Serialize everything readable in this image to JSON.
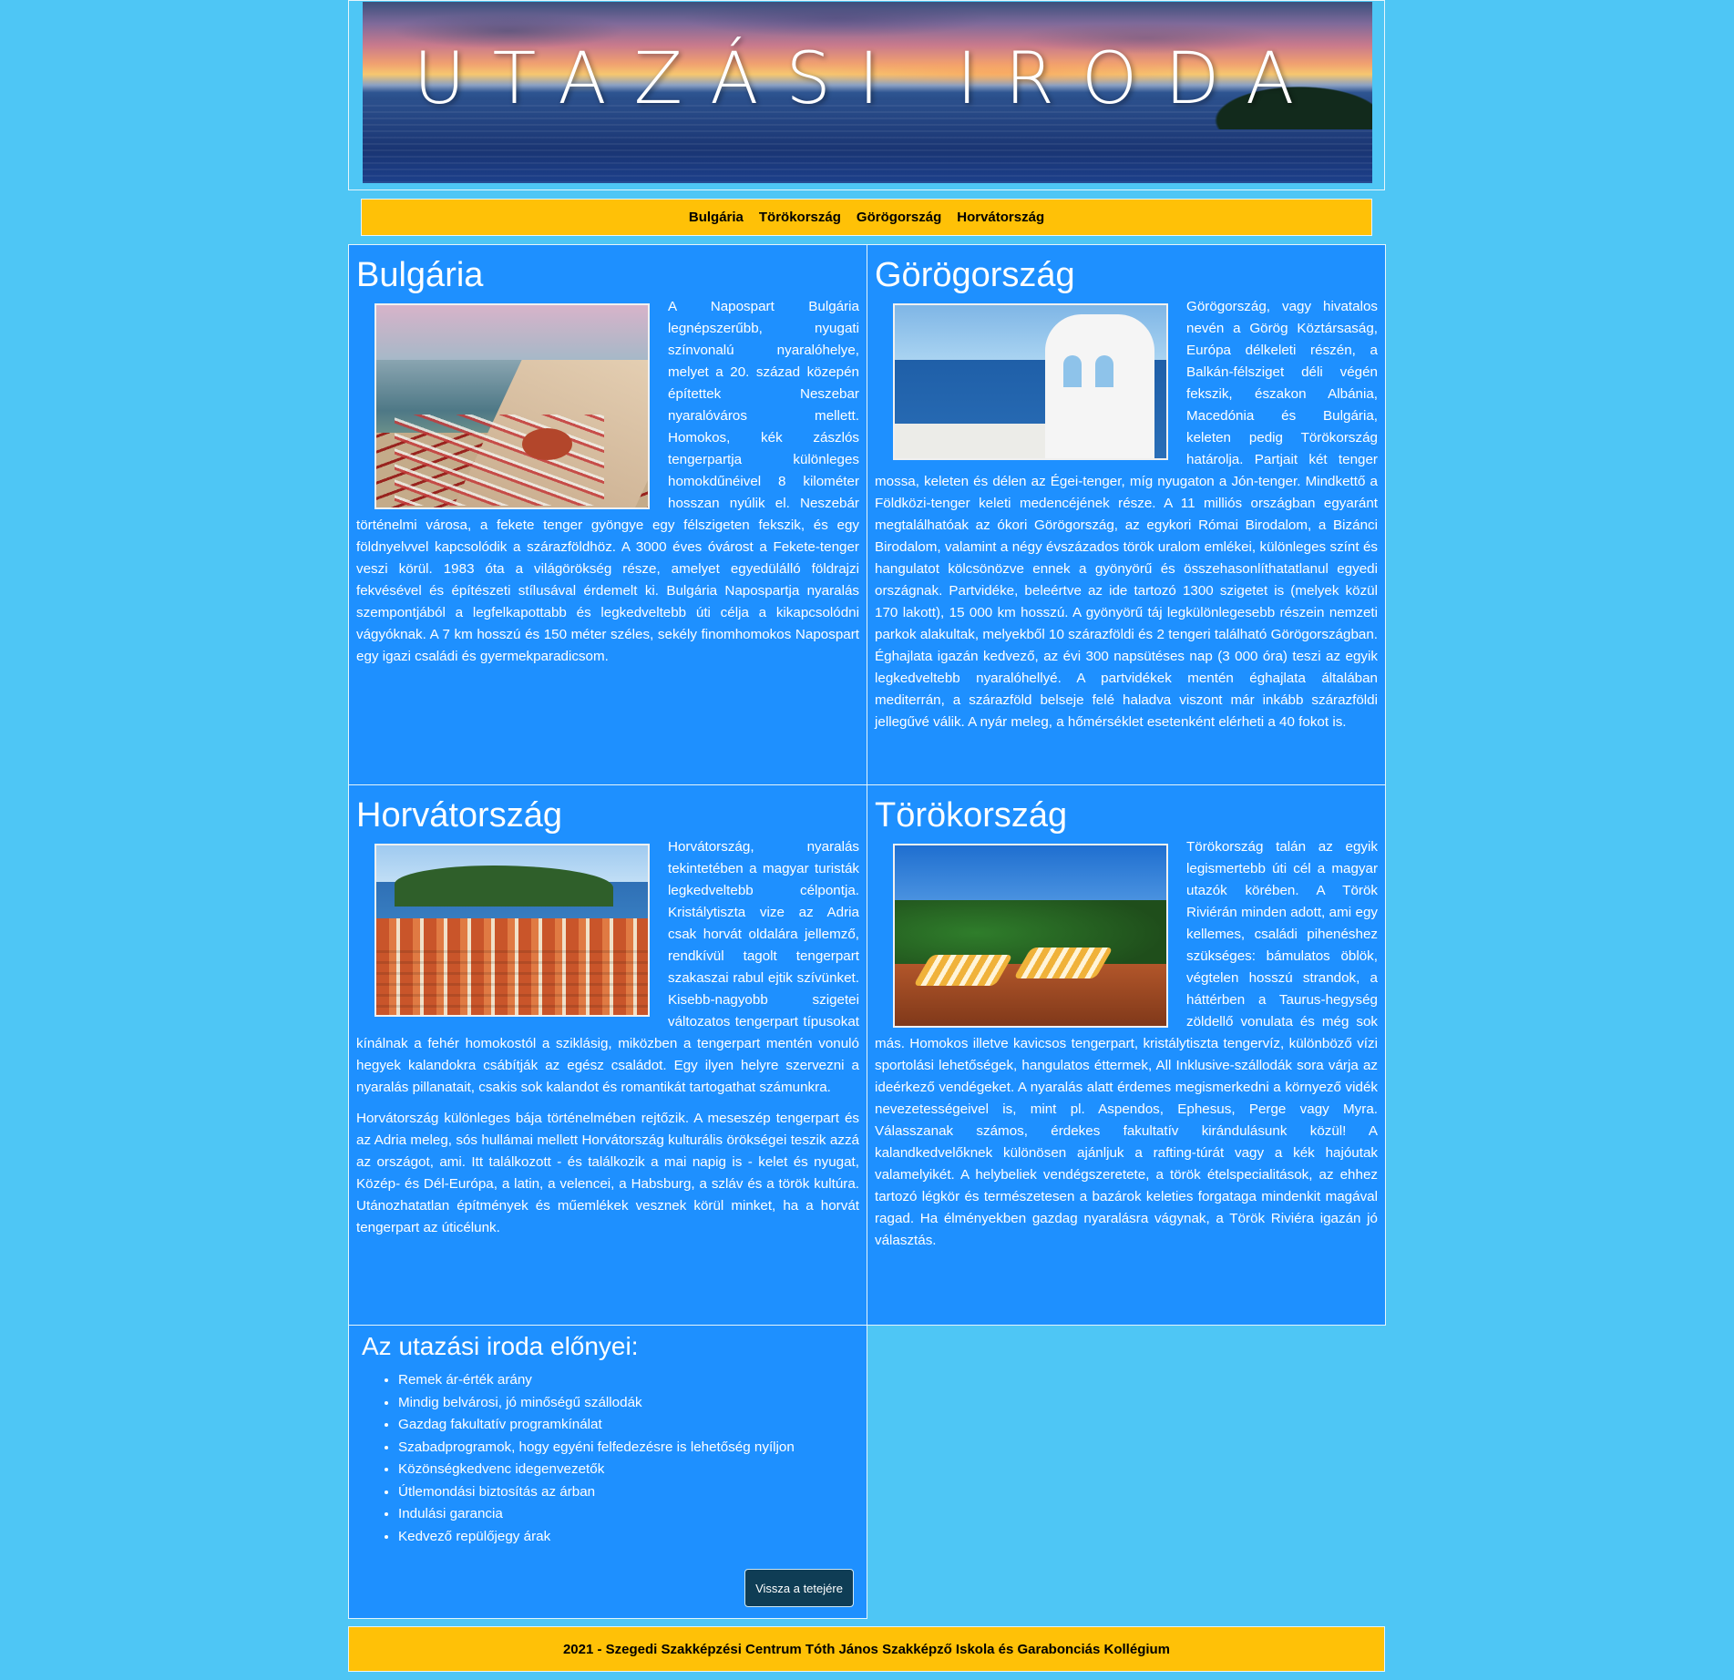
{
  "header": {
    "title": "UTAZÁSI IRODA"
  },
  "nav": {
    "items": [
      {
        "label": "Bulgária"
      },
      {
        "label": "Törökország"
      },
      {
        "label": "Görögország"
      },
      {
        "label": "Horvátország"
      }
    ]
  },
  "sections": {
    "bulgaria": {
      "title": "Bulgária",
      "text": "A Napospart Bulgária legnépszerűbb, nyugati színvonalú nyaralóhelye, melyet a 20. század közepén építettek Neszebar nyaralóváros mellett. Homokos, kék zászlós tengerpartja különleges homokdűnéivel 8 kilométer hosszan nyúlik el. Neszebár történelmi városa, a fekete tenger gyöngye egy félszigeten fekszik, és egy földnyelvvel kapcsolódik a szárazföldhöz. A 3000 éves óvárost a Fekete-tenger veszi körül. 1983 óta a világörökség része, amelyet egyedülálló földrajzi fekvésével és építészeti stílusával érdemelt ki. Bulgária Napospartja nyaralás szempontjából a legfelkapottabb és legkedveltebb úti célja a kikapcsolódni vágyóknak. A 7 km hosszú és 150 méter széles, sekély finomhomokos Napospart egy igazi családi és gyermekparadicsom."
    },
    "greece": {
      "title": "Görögország",
      "text": "Görögország, vagy hivatalos nevén a Görög Köztársaság, Európa délkeleti részén, a Balkán-félsziget déli végén fekszik, északon Albánia, Macedónia és Bulgária, keleten pedig Törökország határolja. Partjait két tenger mossa, keleten és délen az Égei-tenger, míg nyugaton a Jón-tenger. Mindkettő a Földközi-tenger keleti medencéjének része. A 11 milliós országban egyaránt megtalálhatóak az ókori Görögország, az egykori Római Birodalom, a Bizánci Birodalom, valamint a négy évszázados török uralom emlékei, különleges színt és hangulatot kölcsönözve ennek a gyönyörű és összehasonlíthatatlanul egyedi országnak. Partvidéke, beleértve az ide tartozó 1300 szigetet is (melyek közül 170 lakott), 15 000 km hosszú. A gyönyörű táj legkülönlegesebb részein nemzeti parkok alakultak, melyekből 10 szárazföldi és 2 tengeri található Görögországban. Éghajlata igazán kedvező, az évi 300 napsütéses nap (3 000 óra) teszi az egyik legkedveltebb nyaralóhellyé. A partvidékek mentén éghajlata általában mediterrán, a szárazföld belseje felé haladva viszont már inkább szárazföldi jellegűvé válik. A nyár meleg, a hőmérséklet esetenként elérheti a 40 fokot is."
    },
    "croatia": {
      "title": "Horvátország",
      "text1": "Horvátország, nyaralás tekintetében a magyar turisták legkedveltebb célpontja. Kristálytiszta vize az Adria csak horvát oldalára jellemző, rendkívül tagolt tengerpart szakaszai rabul ejtik szívünket. Kisebb-nagyobb szigetei változatos tengerpart típusokat kínálnak a fehér homokostól a sziklásig, miközben a tengerpart mentén vonuló hegyek kalandokra csábítják az egész családot. Egy ilyen helyre szervezni a nyaralás pillanatait, csakis sok kalandot és romantikát tartogathat számunkra.",
      "text2": "Horvátország különleges bája történelmében rejtőzik. A meseszép tengerpart és az Adria meleg, sós hullámai mellett Horvátország kulturális örökségei teszik azzá az országot, ami. Itt találkozott - és találkozik a mai napig is - kelet és nyugat, Közép- és Dél-Európa, a latin, a velencei, a Habsburg, a szláv és a török kultúra. Utánozhatatlan építmények és műemlékek vesznek körül minket, ha a horvát tengerpart az úticélunk."
    },
    "turkey": {
      "title": "Törökország",
      "text": "Törökország talán az egyik legismertebb úti cél a magyar utazók körében. A Török Riviérán minden adott, ami egy kellemes, családi pihenéshez szükséges: bámulatos öblök, végtelen hosszú strandok, a háttérben a Taurus-hegység zöldellő vonulata és még sok más. Homokos illetve kavicsos tengerpart, kristálytiszta tengervíz, különböző vízi sportolási lehetőségek, hangulatos éttermek, All Inklusive-szállodák sora várja az ideérkező vendégeket. A nyaralás alatt érdemes megismerkedni a környező vidék nevezetességeivel is, mint pl. Aspendos, Ephesus, Perge vagy Myra. Válasszanak számos, érdekes fakultatív kirándulásunk közül! A kalandkedvelőknek különösen ajánljuk a rafting-túrát vagy a kék hajóutak valamelyikét. A helybeliek vendégszeretete, a török ételspecialitások, az ehhez tartozó légkör és természetesen a bazárok keleties forgataga mindenkit magával ragad. Ha élményekben gazdag nyaralásra vágynak, a Török Riviéra igazán jó választás."
    }
  },
  "advantages": {
    "title": "Az utazási iroda előnyei:",
    "items": [
      "Remek ár-érték arány",
      "Mindig belvárosi, jó minőségű szállodák",
      "Gazdag fakultatív programkínálat",
      "Szabadprogramok, hogy egyéni felfedezésre is lehetőség nyíljon",
      "Közönségkedvenc idegenvezetők",
      "Útlemondási biztosítás az árban",
      "Indulási garancia",
      "Kedvező repülőjegy árak"
    ],
    "back_to_top": "Vissza a tetejére"
  },
  "footer": {
    "text": "2021 - Szegedi Szakképzési Centrum Tóth János Szakképző Iskola és Garabonciás Kollégium"
  },
  "colors": {
    "page_bg": "#4ec6f5",
    "card_bg": "#1e90ff",
    "nav_bg": "#ffc107",
    "button_bg": "#0f3d55"
  }
}
